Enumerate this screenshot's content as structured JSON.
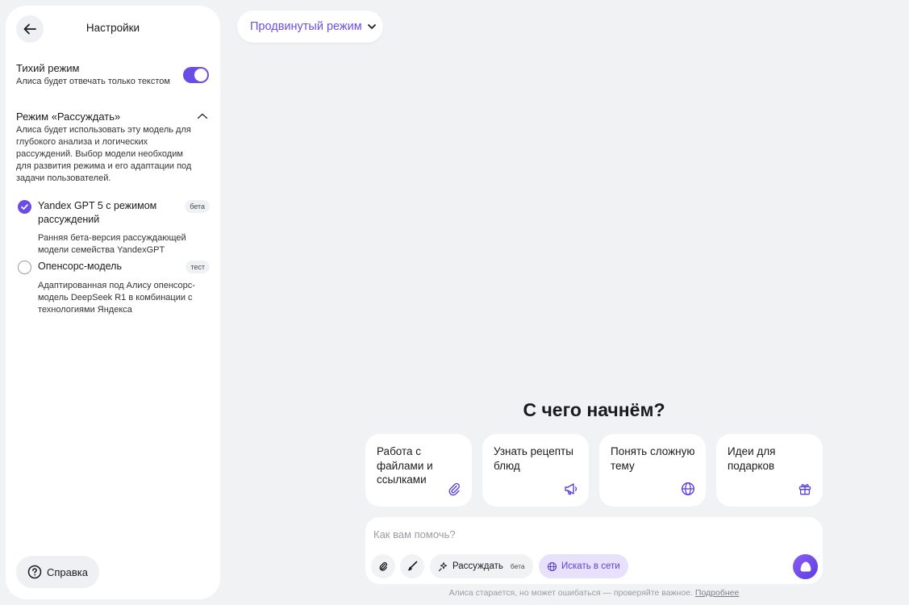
{
  "colors": {
    "accent": "#6b4ce6",
    "background": "#f1f2f4",
    "panel": "#ffffff"
  },
  "sidebar": {
    "back_icon": "arrow-left-icon",
    "title": "Настройки",
    "quiet_mode": {
      "title": "Тихий режим",
      "description": "Алиса будет отвечать только текстом",
      "enabled": true
    },
    "reasoning": {
      "title": "Режим «Рассуждать»",
      "description": "Алиса будет использовать эту модель для глубокого анализа и логических рассуждений. Выбор модели необходим для развития режима и его адаптации под задачи пользователей.",
      "expanded": true,
      "options": [
        {
          "name": "Yandex GPT 5 с режимом рассуждений",
          "badge": "бета",
          "description": "Ранняя бета-версия рассуждающей модели семейства YandexGPT",
          "selected": true
        },
        {
          "name": "Опенсорс-модель",
          "badge": "тест",
          "description": "Адаптированная под Алису опенсорс-модель DeepSeek R1 в комбинации с технологиями Яндекса",
          "selected": false
        }
      ]
    },
    "help_label": "Справка"
  },
  "header": {
    "mode_label": "Продвинутый режим"
  },
  "main": {
    "headline": "С чего начнём?",
    "cards": [
      {
        "label": "Работа с файлами и ссылками",
        "icon": "paperclip-icon"
      },
      {
        "label": "Узнать рецепты блюд",
        "icon": "megaphone-icon"
      },
      {
        "label": "Понять сложную тему",
        "icon": "globe-icon"
      },
      {
        "label": "Идеи для подарков",
        "icon": "gift-icon"
      }
    ],
    "input": {
      "placeholder": "Как вам помочь?",
      "value": ""
    },
    "toolbar": {
      "think_label": "Рассуждать",
      "think_badge": "бета",
      "web_label": "Искать в сети"
    },
    "footer": {
      "text": "Алиса старается, но может ошибаться — проверяйте важное.",
      "link": "Подробнее"
    }
  }
}
